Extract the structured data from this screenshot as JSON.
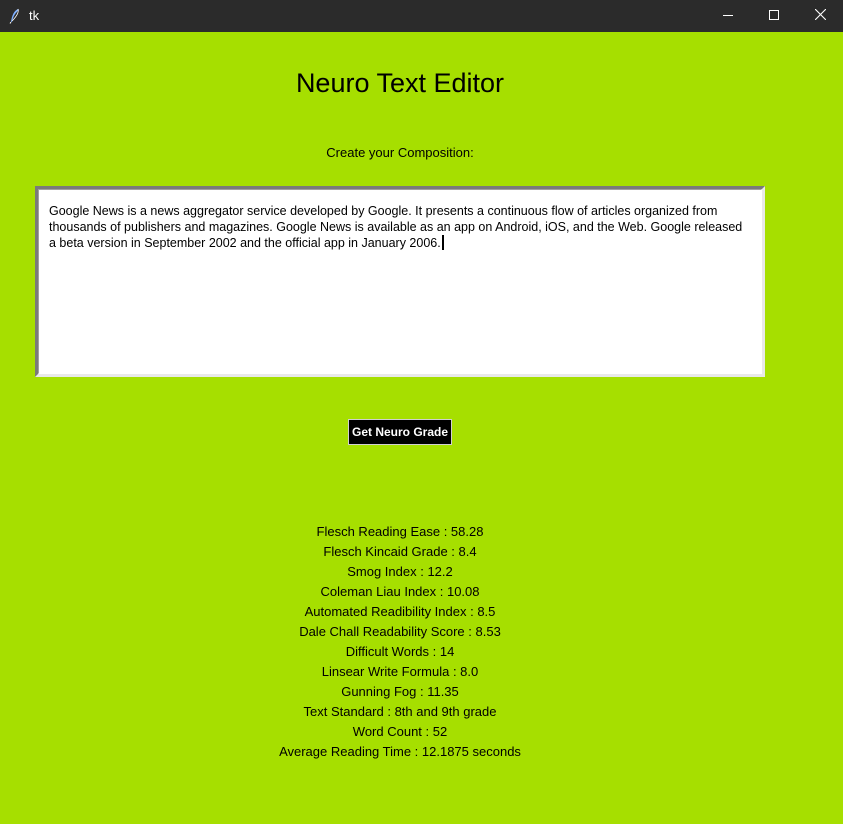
{
  "window": {
    "title": "tk",
    "background_color": "#a6df00",
    "titlebar_color": "#2b2b2b",
    "controls": {
      "minimize": "minimize-icon",
      "maximize": "maximize-icon",
      "close": "close-icon"
    }
  },
  "app": {
    "heading": "Neuro Text Editor",
    "prompt_label": "Create your Composition:"
  },
  "editor": {
    "content": "Google News is a news aggregator service developed by Google. It presents a continuous flow of articles organized from thousands of publishers and magazines. Google News is available as an app on Android, iOS, and the Web. Google released a beta version in September 2002 and the official app in January 2006."
  },
  "action": {
    "button_label": "Get Neuro Grade",
    "button_color": "#000000"
  },
  "results": [
    "Flesch Reading Ease : 58.28",
    "Flesch Kincaid Grade : 8.4",
    "Smog Index : 12.2",
    "Coleman Liau Index : 10.08",
    "Automated Readibility Index : 8.5",
    "Dale Chall Readability Score : 8.53",
    "Difficult Words : 14",
    "Linsear Write Formula : 8.0",
    "Gunning Fog : 11.35",
    "Text Standard : 8th and 9th grade",
    "Word Count : 52",
    "Average Reading Time : 12.1875 seconds"
  ]
}
